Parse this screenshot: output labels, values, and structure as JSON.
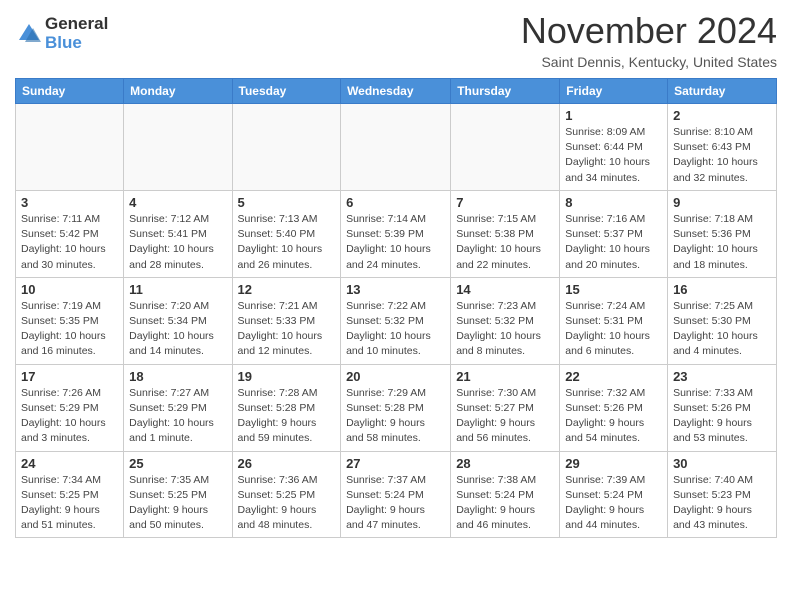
{
  "header": {
    "logo_line1": "General",
    "logo_line2": "Blue",
    "month_title": "November 2024",
    "location": "Saint Dennis, Kentucky, United States"
  },
  "weekdays": [
    "Sunday",
    "Monday",
    "Tuesday",
    "Wednesday",
    "Thursday",
    "Friday",
    "Saturday"
  ],
  "weeks": [
    [
      {
        "day": "",
        "info": ""
      },
      {
        "day": "",
        "info": ""
      },
      {
        "day": "",
        "info": ""
      },
      {
        "day": "",
        "info": ""
      },
      {
        "day": "",
        "info": ""
      },
      {
        "day": "1",
        "info": "Sunrise: 8:09 AM\nSunset: 6:44 PM\nDaylight: 10 hours and 34 minutes."
      },
      {
        "day": "2",
        "info": "Sunrise: 8:10 AM\nSunset: 6:43 PM\nDaylight: 10 hours and 32 minutes."
      }
    ],
    [
      {
        "day": "3",
        "info": "Sunrise: 7:11 AM\nSunset: 5:42 PM\nDaylight: 10 hours and 30 minutes."
      },
      {
        "day": "4",
        "info": "Sunrise: 7:12 AM\nSunset: 5:41 PM\nDaylight: 10 hours and 28 minutes."
      },
      {
        "day": "5",
        "info": "Sunrise: 7:13 AM\nSunset: 5:40 PM\nDaylight: 10 hours and 26 minutes."
      },
      {
        "day": "6",
        "info": "Sunrise: 7:14 AM\nSunset: 5:39 PM\nDaylight: 10 hours and 24 minutes."
      },
      {
        "day": "7",
        "info": "Sunrise: 7:15 AM\nSunset: 5:38 PM\nDaylight: 10 hours and 22 minutes."
      },
      {
        "day": "8",
        "info": "Sunrise: 7:16 AM\nSunset: 5:37 PM\nDaylight: 10 hours and 20 minutes."
      },
      {
        "day": "9",
        "info": "Sunrise: 7:18 AM\nSunset: 5:36 PM\nDaylight: 10 hours and 18 minutes."
      }
    ],
    [
      {
        "day": "10",
        "info": "Sunrise: 7:19 AM\nSunset: 5:35 PM\nDaylight: 10 hours and 16 minutes."
      },
      {
        "day": "11",
        "info": "Sunrise: 7:20 AM\nSunset: 5:34 PM\nDaylight: 10 hours and 14 minutes."
      },
      {
        "day": "12",
        "info": "Sunrise: 7:21 AM\nSunset: 5:33 PM\nDaylight: 10 hours and 12 minutes."
      },
      {
        "day": "13",
        "info": "Sunrise: 7:22 AM\nSunset: 5:32 PM\nDaylight: 10 hours and 10 minutes."
      },
      {
        "day": "14",
        "info": "Sunrise: 7:23 AM\nSunset: 5:32 PM\nDaylight: 10 hours and 8 minutes."
      },
      {
        "day": "15",
        "info": "Sunrise: 7:24 AM\nSunset: 5:31 PM\nDaylight: 10 hours and 6 minutes."
      },
      {
        "day": "16",
        "info": "Sunrise: 7:25 AM\nSunset: 5:30 PM\nDaylight: 10 hours and 4 minutes."
      }
    ],
    [
      {
        "day": "17",
        "info": "Sunrise: 7:26 AM\nSunset: 5:29 PM\nDaylight: 10 hours and 3 minutes."
      },
      {
        "day": "18",
        "info": "Sunrise: 7:27 AM\nSunset: 5:29 PM\nDaylight: 10 hours and 1 minute."
      },
      {
        "day": "19",
        "info": "Sunrise: 7:28 AM\nSunset: 5:28 PM\nDaylight: 9 hours and 59 minutes."
      },
      {
        "day": "20",
        "info": "Sunrise: 7:29 AM\nSunset: 5:28 PM\nDaylight: 9 hours and 58 minutes."
      },
      {
        "day": "21",
        "info": "Sunrise: 7:30 AM\nSunset: 5:27 PM\nDaylight: 9 hours and 56 minutes."
      },
      {
        "day": "22",
        "info": "Sunrise: 7:32 AM\nSunset: 5:26 PM\nDaylight: 9 hours and 54 minutes."
      },
      {
        "day": "23",
        "info": "Sunrise: 7:33 AM\nSunset: 5:26 PM\nDaylight: 9 hours and 53 minutes."
      }
    ],
    [
      {
        "day": "24",
        "info": "Sunrise: 7:34 AM\nSunset: 5:25 PM\nDaylight: 9 hours and 51 minutes."
      },
      {
        "day": "25",
        "info": "Sunrise: 7:35 AM\nSunset: 5:25 PM\nDaylight: 9 hours and 50 minutes."
      },
      {
        "day": "26",
        "info": "Sunrise: 7:36 AM\nSunset: 5:25 PM\nDaylight: 9 hours and 48 minutes."
      },
      {
        "day": "27",
        "info": "Sunrise: 7:37 AM\nSunset: 5:24 PM\nDaylight: 9 hours and 47 minutes."
      },
      {
        "day": "28",
        "info": "Sunrise: 7:38 AM\nSunset: 5:24 PM\nDaylight: 9 hours and 46 minutes."
      },
      {
        "day": "29",
        "info": "Sunrise: 7:39 AM\nSunset: 5:24 PM\nDaylight: 9 hours and 44 minutes."
      },
      {
        "day": "30",
        "info": "Sunrise: 7:40 AM\nSunset: 5:23 PM\nDaylight: 9 hours and 43 minutes."
      }
    ]
  ]
}
